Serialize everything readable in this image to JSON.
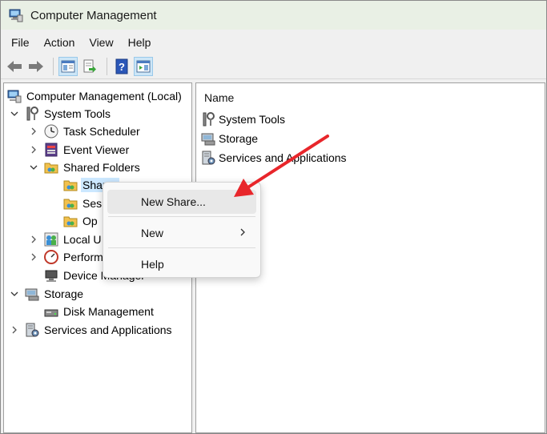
{
  "window": {
    "title": "Computer Management",
    "icon": "computer-management-icon"
  },
  "menubar": {
    "items": [
      "File",
      "Action",
      "View",
      "Help"
    ]
  },
  "toolbar": {
    "buttons": [
      {
        "name": "back-arrow-icon"
      },
      {
        "name": "forward-arrow-icon"
      },
      {
        "name": "show-hide-console-tree-icon",
        "pressed": true
      },
      {
        "name": "export-list-icon"
      },
      {
        "name": "help-icon"
      },
      {
        "name": "show-hide-action-pane-icon",
        "pressed": true
      }
    ]
  },
  "tree": {
    "root": "Computer Management (Local)",
    "system_tools": "System Tools",
    "task_scheduler": "Task Scheduler",
    "event_viewer": "Event Viewer",
    "shared_folders": "Shared Folders",
    "shares": "Shares",
    "sessions": "Ses",
    "open_files": "Op",
    "local_users": "Local U",
    "performance": "Perform",
    "device_manager": "Device Manager",
    "storage": "Storage",
    "disk_management": "Disk Management",
    "services_apps": "Services and Applications"
  },
  "list": {
    "column_header": "Name",
    "items": [
      "System Tools",
      "Storage",
      "Services and Applications"
    ]
  },
  "context_menu": {
    "new_share": "New Share...",
    "new": "New",
    "help": "Help"
  },
  "colors": {
    "accent_selection": "#cce8ff",
    "annotation_arrow": "#e8262b"
  }
}
